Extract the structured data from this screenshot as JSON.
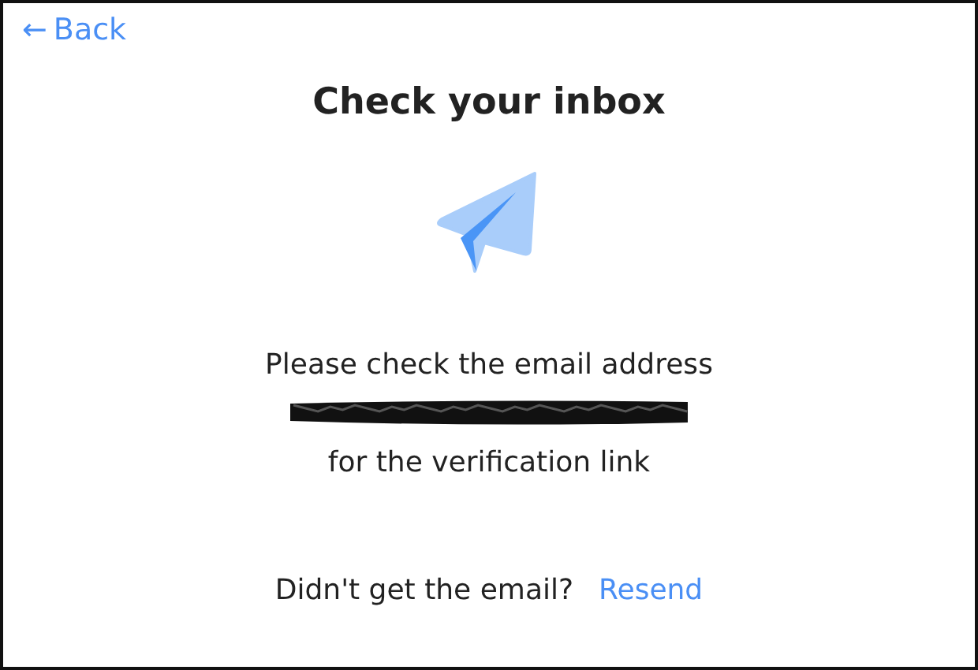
{
  "back_link": {
    "icon": "←",
    "label": "Back"
  },
  "title": "Check your inbox",
  "message": {
    "before": "Please check the email address",
    "email_redacted": true,
    "after": "for the verification link"
  },
  "footer": {
    "prompt": "Didn't get the email?",
    "link": "Resend"
  }
}
